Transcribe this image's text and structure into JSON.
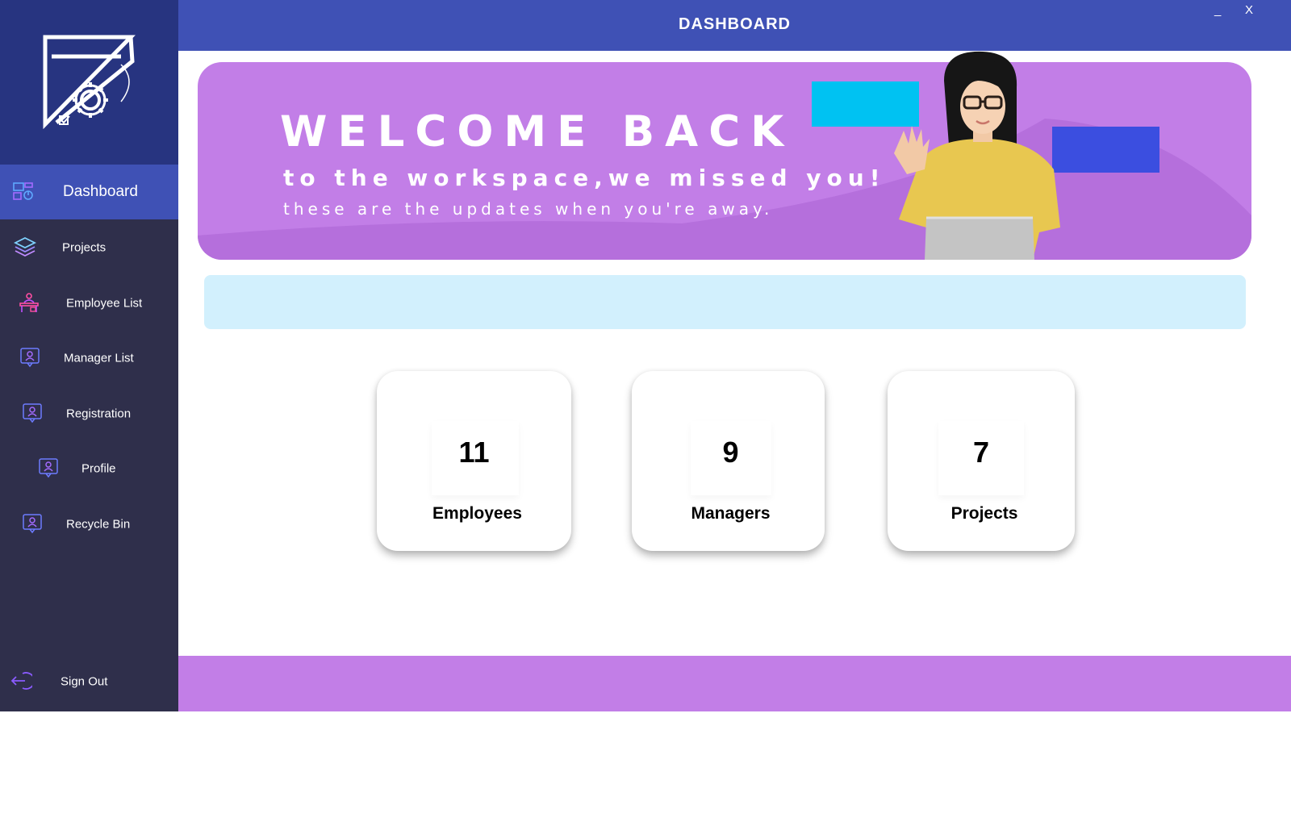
{
  "header": {
    "title": "DASHBOARD",
    "minimize_label": "_",
    "close_label": "X"
  },
  "sidebar": {
    "logo_icon": "set-square-gear-logo",
    "items": [
      {
        "label": "Dashboard",
        "icon": "dashboard-icon",
        "active": true
      },
      {
        "label": "Projects",
        "icon": "layers-icon",
        "active": false
      },
      {
        "label": "Employee List",
        "icon": "employee-desk-icon",
        "active": false
      },
      {
        "label": "Manager List",
        "icon": "user-badge-icon",
        "active": false
      },
      {
        "label": "Registration",
        "icon": "user-badge-icon",
        "active": false
      },
      {
        "label": "Profile",
        "icon": "user-badge-icon",
        "active": false
      },
      {
        "label": "Recycle Bin",
        "icon": "user-badge-icon",
        "active": false
      }
    ],
    "sign_out": {
      "label": "Sign Out",
      "icon": "sign-out-icon"
    }
  },
  "banner": {
    "title": "WELCOME BACK",
    "subtitle": "to the workspace,we missed you!",
    "subtitle2": "these are the updates when you're away."
  },
  "stats": [
    {
      "value": "11",
      "label": "Employees"
    },
    {
      "value": "9",
      "label": "Managers"
    },
    {
      "value": "7",
      "label": "Projects"
    }
  ],
  "colors": {
    "sidebar_bg": "#2f2f4b",
    "logo_bg": "#273480",
    "accent_blue": "#3f51b5",
    "banner_purple": "#c27ee7",
    "info_bar": "#d2f0fd",
    "cyan_block": "#00c2f2",
    "blue_block": "#3b4ee0"
  }
}
